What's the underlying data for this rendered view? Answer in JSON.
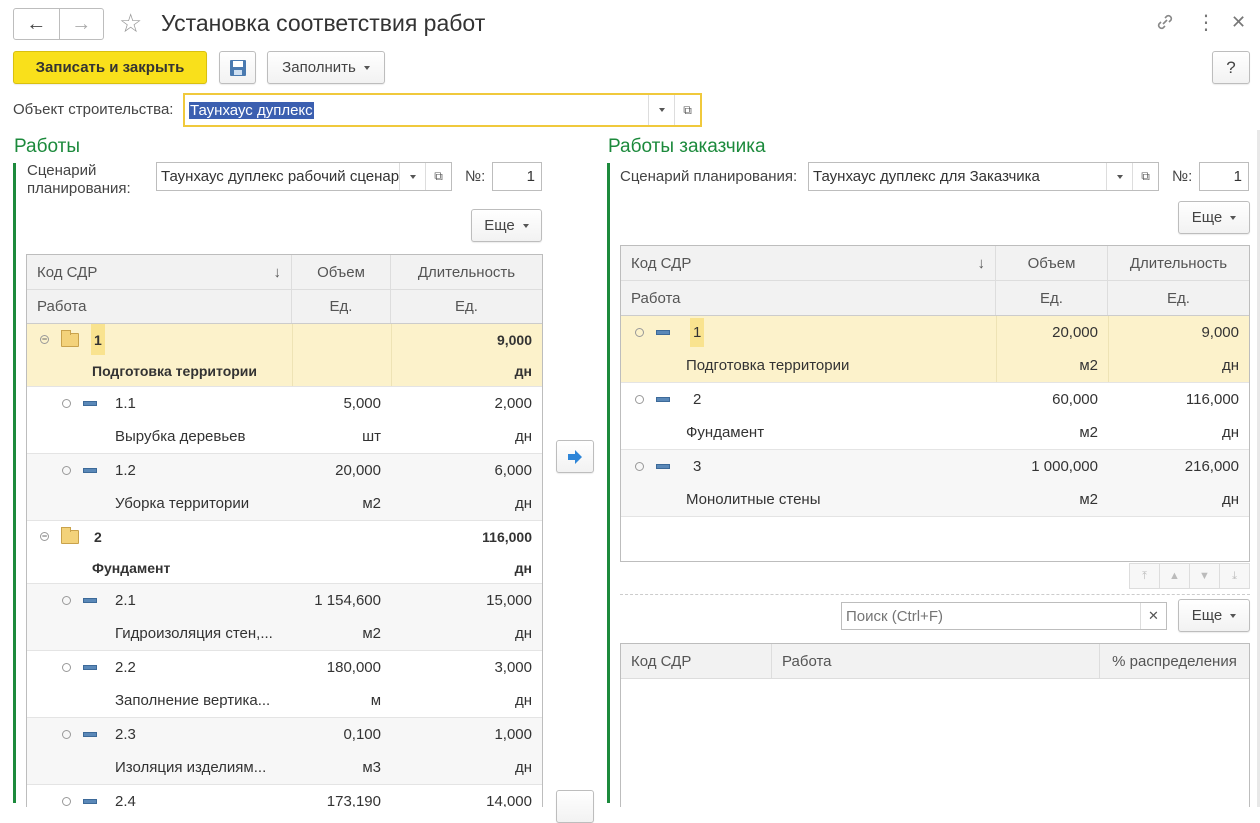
{
  "header": {
    "title": "Установка соответствия работ",
    "back_icon": "←",
    "forward_icon": "→",
    "star_icon": "☆",
    "link_icon": "🔗",
    "more_icon": "⋮",
    "close_icon": "✕"
  },
  "toolbar": {
    "save_close_label": "Записать и закрыть",
    "fill_label": "Заполнить",
    "help_label": "?"
  },
  "object": {
    "label": "Объект строительства:",
    "value": "Таунхаус дуплекс"
  },
  "left": {
    "section_title": "Работы",
    "scenario_label_1": "Сценарий",
    "scenario_label_2": "планирования:",
    "scenario_value": "Таунхаус дуплекс рабочий сценарий",
    "num_label": "№:",
    "num_value": "1",
    "more_label": "Еще",
    "columns": {
      "code": "Код СДР",
      "volume": "Объем",
      "duration": "Длительность",
      "work": "Работа",
      "unit1": "Ед.",
      "unit2": "Ед."
    },
    "sort_icon": "↓",
    "rows": [
      {
        "code": "1",
        "name": "Подготовка территории",
        "volume": "",
        "unit": "",
        "duration": "9,000",
        "dunit": "дн"
      },
      {
        "code": "1.1",
        "name": "Вырубка деревьев",
        "volume": "5,000",
        "unit": "шт",
        "duration": "2,000",
        "dunit": "дн"
      },
      {
        "code": "1.2",
        "name": "Уборка территории",
        "volume": "20,000",
        "unit": "м2",
        "duration": "6,000",
        "dunit": "дн"
      },
      {
        "code": "2",
        "name": "Фундамент",
        "volume": "",
        "unit": "",
        "duration": "116,000",
        "dunit": "дн"
      },
      {
        "code": "2.1",
        "name": "Гидроизоляция стен,...",
        "volume": "1 154,600",
        "unit": "м2",
        "duration": "15,000",
        "dunit": "дн"
      },
      {
        "code": "2.2",
        "name": "Заполнение вертика...",
        "volume": "180,000",
        "unit": "м",
        "duration": "3,000",
        "dunit": "дн"
      },
      {
        "code": "2.3",
        "name": "Изоляция изделиям...",
        "volume": "0,100",
        "unit": "м3",
        "duration": "1,000",
        "dunit": "дн"
      },
      {
        "code": "2.4",
        "name": "",
        "volume": "173,190",
        "unit": "",
        "duration": "14,000",
        "dunit": ""
      }
    ]
  },
  "transfer_icon": "➡",
  "right": {
    "section_title": "Работы заказчика",
    "scenario_label": "Сценарий планирования:",
    "scenario_value": "Таунхаус дуплекс для Заказчика",
    "num_label": "№:",
    "num_value": "1",
    "more_label": "Еще",
    "columns": {
      "code": "Код СДР",
      "volume": "Объем",
      "duration": "Длительность",
      "work": "Работа",
      "unit1": "Ед.",
      "unit2": "Ед."
    },
    "sort_icon": "↓",
    "rows": [
      {
        "code": "1",
        "name": "Подготовка территории",
        "volume": "20,000",
        "unit": "м2",
        "duration": "9,000",
        "dunit": "дн"
      },
      {
        "code": "2",
        "name": "Фундамент",
        "volume": "60,000",
        "unit": "м2",
        "duration": "116,000",
        "dunit": "дн"
      },
      {
        "code": "3",
        "name": "Монолитные стены",
        "volume": "1 000,000",
        "unit": "м2",
        "duration": "216,000",
        "dunit": "дн"
      }
    ],
    "search_placeholder": "Поиск (Ctrl+F)",
    "search_clear_icon": "✕",
    "more2_label": "Еще",
    "dist_columns": {
      "code": "Код СДР",
      "work": "Работа",
      "percent": "% распределения"
    }
  }
}
